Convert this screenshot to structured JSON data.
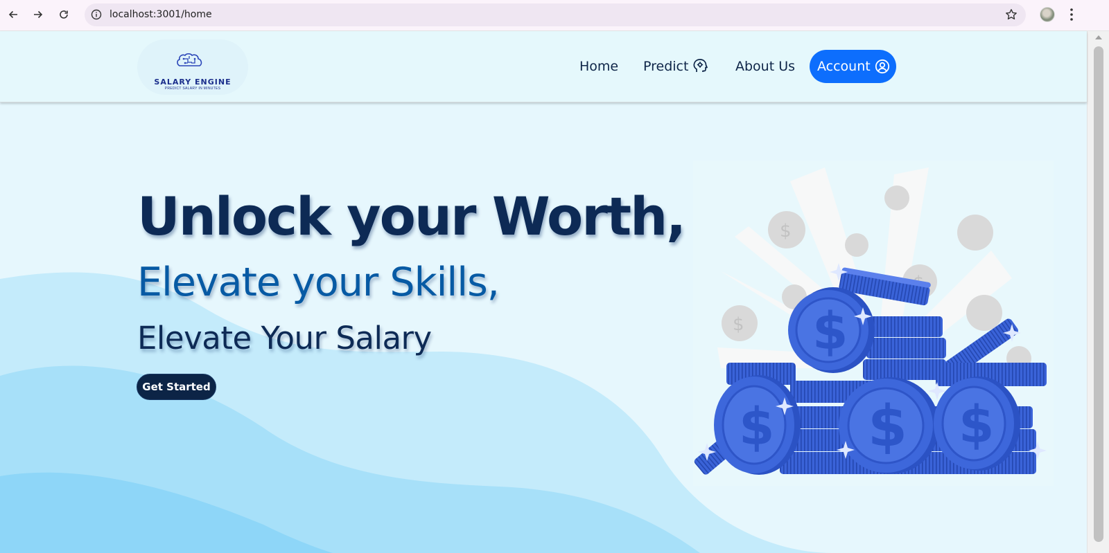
{
  "browser": {
    "url": "localhost:3001/home",
    "icons": [
      "back-arrow-icon",
      "forward-arrow-icon",
      "reload-icon",
      "info-icon",
      "bookmark-star-icon",
      "profile-avatar",
      "kebab-menu-icon"
    ]
  },
  "header": {
    "logo_title": "SALARY ENGINE",
    "logo_tagline": "PREDICT SALARY IN MINUTES",
    "nav": {
      "home": "Home",
      "predict": "Predict",
      "about": "About Us",
      "account": "Account"
    },
    "accent_color": "#0d6efd"
  },
  "hero": {
    "headline": "Unlock your Worth,",
    "subheadline": "Elevate your Skills,",
    "tagline": "Elevate Your Salary",
    "cta": "Get Started",
    "illustration": "stack-of-blue-dollar-coins"
  },
  "colors": {
    "headline": "#0d2a55",
    "subheadline": "#075aa4",
    "cta_background": "#0c2446",
    "page_background": "#e6f7fd"
  }
}
